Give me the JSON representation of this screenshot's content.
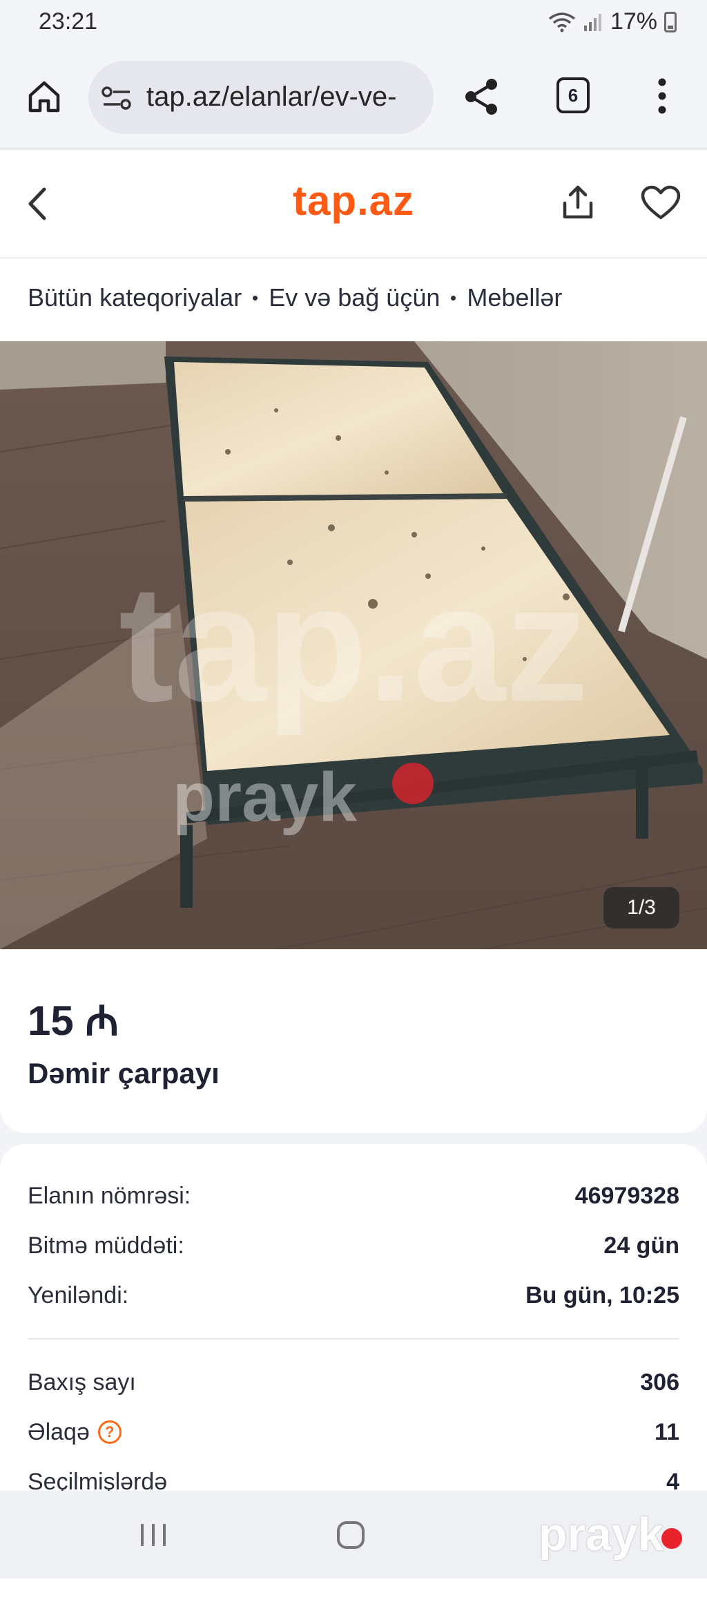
{
  "status_bar": {
    "time": "23:21",
    "battery": "17%"
  },
  "browser": {
    "url": "tap.az/elanlar/ev-ve-",
    "tab_count": "6"
  },
  "site": {
    "logo": "tap.az"
  },
  "breadcrumb": [
    "Bütün kateqoriyalar",
    "Ev və bağ üçün",
    "Mebellər"
  ],
  "gallery": {
    "counter": "1/3",
    "watermark": "tap.az",
    "overlay_logo": "prayk"
  },
  "listing": {
    "price": "15 ₼",
    "title": "Dəmir çarpayı"
  },
  "details": [
    {
      "label": "Elanın nömrəsi:",
      "value": "46979328"
    },
    {
      "label": "Bitmə müddəti:",
      "value": "24 gün"
    },
    {
      "label": "Yeniləndi:",
      "value": "Bu gün, 10:25"
    }
  ],
  "stats": [
    {
      "label": "Baxış sayı",
      "value": "306"
    },
    {
      "label": "Əlaqə",
      "value": "11",
      "help": "?"
    },
    {
      "label": "Seçilmişlərdə",
      "value": "4"
    }
  ],
  "footer": {
    "watermark": "prayk"
  },
  "colors": {
    "brand": "#ff5a14",
    "help": "#ff6a1a",
    "watermark_dot": "#e8232b"
  }
}
